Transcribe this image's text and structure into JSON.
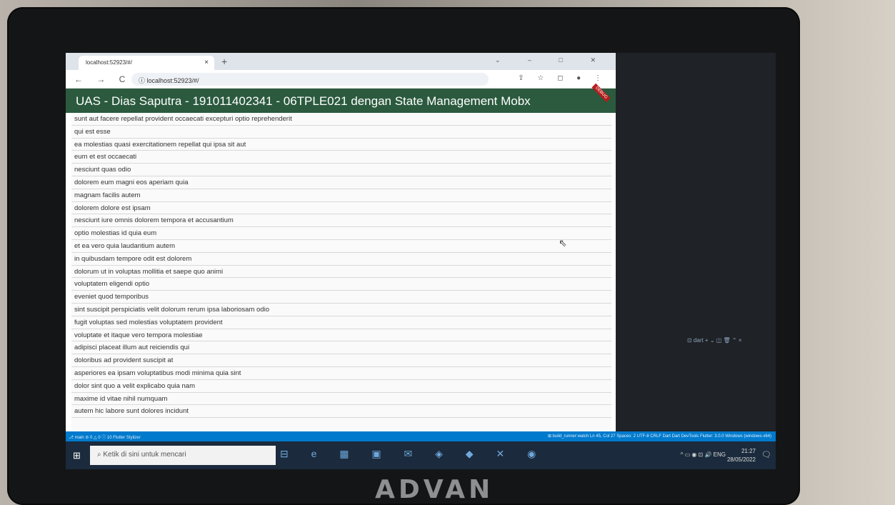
{
  "browser": {
    "tab_title": "localhost:52923/#/",
    "tab_close": "×",
    "new_tab": "+",
    "window_controls": "⌄ – □ ✕",
    "nav_buttons": "← → C",
    "url": "ⓘ  localhost:52923/#/",
    "address_icons": "⇪ ☆ ◻ ● ⋮"
  },
  "app": {
    "title": "UAS - Dias Saputra - 191011402341 - 06TPLE021 dengan State Management Mobx",
    "debug_banner": "DEBUG",
    "items": [
      "sunt aut facere repellat provident occaecati excepturi optio reprehenderit",
      "qui est esse",
      "ea molestias quasi exercitationem repellat qui ipsa sit aut",
      "eum et est occaecati",
      "nesciunt quas odio",
      "dolorem eum magni eos aperiam quia",
      "magnam facilis autem",
      "dolorem dolore est ipsam",
      "nesciunt iure omnis dolorem tempora et accusantium",
      "optio molestias id quia eum",
      "et ea vero quia laudantium autem",
      "in quibusdam tempore odit est dolorem",
      "dolorum ut in voluptas mollitia et saepe quo animi",
      "voluptatem eligendi optio",
      "eveniet quod temporibus",
      "sint suscipit perspiciatis velit dolorum rerum ipsa laboriosam odio",
      "fugit voluptas sed molestias voluptatem provident",
      "voluptate et itaque vero tempora molestiae",
      "adipisci placeat illum aut reiciendis qui",
      "doloribus ad provident suscipit at",
      "asperiores ea ipsam voluptatibus modi minima quia sint",
      "dolor sint quo a velit explicabo quia nam",
      "maxime id vitae nihil numquam",
      "autem hic labore sunt dolores incidunt"
    ]
  },
  "vscode": {
    "panel_tools": "⊡ dart  + ⌄  ◫  🗑  ⌃  ×",
    "status_left": "⎇ main  ⊘ 0 △ 0  ⓘ 10   Flutter Stylizer",
    "status_right": "⊞ build_runner:watch   Ln 45, Col 27   Spaces: 2   UTF-8   CRLF   Dart   Dart DevTools   Flutter: 3.0.0   Windows (windows-x64)"
  },
  "taskbar": {
    "start_icon": "⊞",
    "search_placeholder": "Ketik di sini untuk mencari",
    "pinned_icons": "⊟ e ▦ ▣ ✉ ◈ ◆ ✕ ◉",
    "tray": "^  ▭  ◉  ⊡  🔊  ENG",
    "time": "21:27",
    "date": "28/05/2022",
    "notification_icon": "🗨"
  },
  "device": {
    "brand": "ADVAN"
  }
}
